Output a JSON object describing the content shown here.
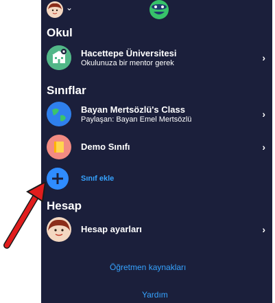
{
  "sections": {
    "okul": "Okul",
    "siniflar": "Sınıflar",
    "hesap": "Hesap"
  },
  "school": {
    "name": "Hacettepe Üniversitesi",
    "subtitle": "Okulunuza bir mentor gerek"
  },
  "classes": [
    {
      "name": "Bayan Mertsözlü's Class",
      "subtitle": "Paylaşan: Bayan Emel Mertsözlü"
    },
    {
      "name": "Demo Sınıfı"
    }
  ],
  "add_class": "Sınıf ekle",
  "account_settings": "Hesap ayarları",
  "footer": {
    "teacher_resources": "Öğretmen kaynakları",
    "help": "Yardım"
  },
  "colors": {
    "background": "#1b1f3b",
    "link": "#36a3ff",
    "arrow": "#e11d1d"
  },
  "icons": {
    "chevron": "chevron-right-icon",
    "add": "plus-circle-icon"
  }
}
